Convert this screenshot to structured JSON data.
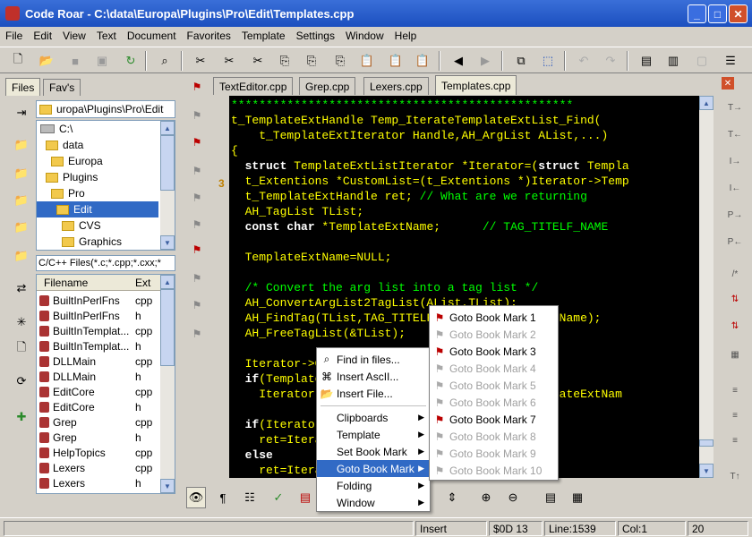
{
  "window": {
    "title": "Code Roar - C:\\data\\Europa\\Plugins\\Pro\\Edit\\Templates.cpp"
  },
  "menu": [
    "File",
    "Edit",
    "View",
    "Text",
    "Document",
    "Favorites",
    "Template",
    "Settings",
    "Window",
    "Help"
  ],
  "panel_tabs": [
    "Files",
    "Fav's"
  ],
  "path_box": "uropa\\Plugins\\Pro\\Edit",
  "tree": [
    {
      "label": "C:\\",
      "indent": 0
    },
    {
      "label": "data",
      "indent": 1
    },
    {
      "label": "Europa",
      "indent": 2
    },
    {
      "label": "Plugins",
      "indent": 3
    },
    {
      "label": "Pro",
      "indent": 4
    },
    {
      "label": "Edit",
      "indent": 5,
      "selected": true
    },
    {
      "label": "CVS",
      "indent": 6
    },
    {
      "label": "Graphics",
      "indent": 6
    }
  ],
  "filter": "C/C++ Files(*.c;*.cpp;*.cxx;*",
  "file_list": {
    "headers": [
      "Filename",
      "Ext"
    ],
    "rows": [
      [
        "BuiltInPerlFns",
        "cpp"
      ],
      [
        "BuiltInPerlFns",
        "h"
      ],
      [
        "BuiltInTemplat...",
        "cpp"
      ],
      [
        "BuiltInTemplat...",
        "h"
      ],
      [
        "DLLMain",
        "cpp"
      ],
      [
        "DLLMain",
        "h"
      ],
      [
        "EditCore",
        "cpp"
      ],
      [
        "EditCore",
        "h"
      ],
      [
        "Grep",
        "cpp"
      ],
      [
        "Grep",
        "h"
      ],
      [
        "HelpTopics",
        "cpp"
      ],
      [
        "Lexers",
        "cpp"
      ],
      [
        "Lexers",
        "h"
      ]
    ]
  },
  "doc_tabs": [
    "TextEditor.cpp",
    "Grep.cpp",
    "Lexers.cpp",
    "Templates.cpp"
  ],
  "active_doc_tab": 3,
  "bookmark_label": "3",
  "code": [
    [
      [
        "cm",
        "*************************************************"
      ]
    ],
    [
      [
        "id",
        "t_TemplateExtHandle Temp_IterateTemplateExtList_Find("
      ]
    ],
    [
      [
        "id",
        "    t_TemplateExtIterator Handle,AH_ArgList AList,...)"
      ]
    ],
    [
      [
        "id",
        "{"
      ]
    ],
    [
      [
        "kw",
        "  struct "
      ],
      [
        "id",
        "TemplateExtListIterator *Iterator=("
      ],
      [
        "kw",
        "struct"
      ],
      [
        "id",
        " Templa"
      ]
    ],
    [
      [
        "id",
        "  t_Extentions *CustomList=(t_Extentions *)Iterator->Temp"
      ]
    ],
    [
      [
        "id",
        "  t_TemplateExtHandle ret; "
      ],
      [
        "cm",
        "// What are we returning"
      ]
    ],
    [
      [
        "id",
        "  AH_TagList TList;"
      ]
    ],
    [
      [
        "kw",
        "  const char "
      ],
      [
        "id",
        "*TemplateExtName;      "
      ],
      [
        "cm",
        "// TAG_TITELF_NAME"
      ]
    ],
    [
      [
        "id",
        ""
      ]
    ],
    [
      [
        "id",
        "  TemplateExtName=NULL;"
      ]
    ],
    [
      [
        "id",
        ""
      ]
    ],
    [
      [
        "cm",
        "  /* Convert the arg list into a tag list */"
      ]
    ],
    [
      [
        "id",
        "  AH_ConvertArgList2TagList(AList,TList);"
      ]
    ],
    [
      [
        "id",
        "  AH_FindTag(TList,TAG_TITELF_NAME,&TemplateExtName);"
      ]
    ],
    [
      [
        "id",
        "  AH_FreeTagList(&TList);"
      ]
    ],
    [
      [
        "id",
        ""
      ]
    ],
    [
      [
        "id",
        "  Iterator->CurrentPos=NULL;"
      ]
    ],
    [
      [
        "kw",
        "  if"
      ],
      [
        "id",
        "(TemplateExtName!=NULL)"
      ]
    ],
    [
      [
        "id",
        "    Iterator->CurrentPos=CustomList->Find(TemplateExtNam"
      ]
    ],
    [
      [
        "id",
        ""
      ]
    ],
    [
      [
        "kw",
        "  if"
      ],
      [
        "id",
        "(Iterator->CurrentPos!=CustomList->end())"
      ]
    ],
    [
      [
        "id",
        "    ret=Iterator->CurrentPos;"
      ]
    ],
    [
      [
        "kw",
        "  else"
      ]
    ],
    [
      [
        "id",
        "    ret=Iterator->CurrentPos;"
      ],
      [
        "id",
        "     ->CurrentPos;"
      ]
    ]
  ],
  "context_menu": {
    "items": [
      {
        "label": "Find in files...",
        "icon": "binoculars-icon"
      },
      {
        "label": "Insert AscII...",
        "icon": "ascii-icon"
      },
      {
        "label": "Insert File...",
        "icon": "open-folder-icon"
      }
    ],
    "submenus": [
      "Clipboards",
      "Template",
      "Set Book Mark",
      "Goto Book Mark",
      "Folding",
      "Window"
    ],
    "highlighted": "Goto Book Mark"
  },
  "goto_submenu": [
    {
      "label": "Goto Book Mark 1",
      "enabled": true
    },
    {
      "label": "Goto Book Mark 2",
      "enabled": false
    },
    {
      "label": "Goto Book Mark 3",
      "enabled": true
    },
    {
      "label": "Goto Book Mark 4",
      "enabled": false
    },
    {
      "label": "Goto Book Mark 5",
      "enabled": false
    },
    {
      "label": "Goto Book Mark 6",
      "enabled": false
    },
    {
      "label": "Goto Book Mark 7",
      "enabled": true
    },
    {
      "label": "Goto Book Mark 8",
      "enabled": false
    },
    {
      "label": "Goto Book Mark 9",
      "enabled": false
    },
    {
      "label": "Goto Book Mark 10",
      "enabled": false
    }
  ],
  "status": {
    "mode": "Insert",
    "char": "$0D  13",
    "line": "Line:1539",
    "col": "Col:1",
    "extra": "20"
  },
  "colors": {
    "editor_bg": "#000000",
    "code_text": "#ffff00",
    "keyword": "#ffffff",
    "comment": "#00ff00",
    "highlight": "#316ac5",
    "title_bar": "#1c4fbf"
  }
}
